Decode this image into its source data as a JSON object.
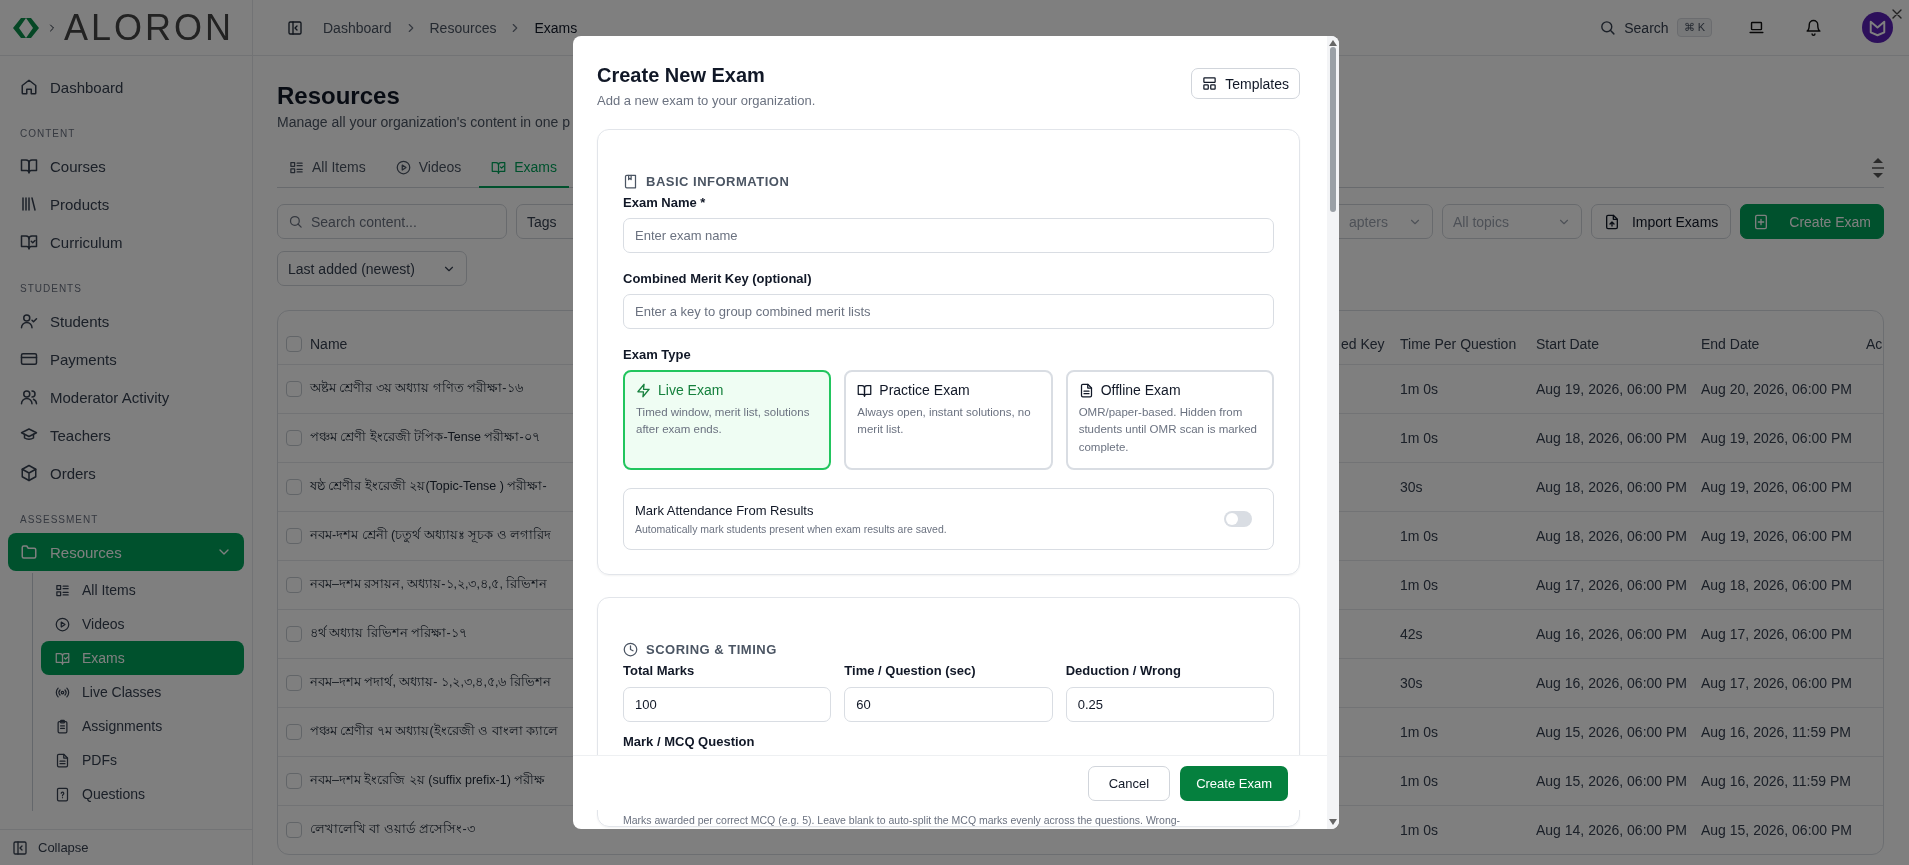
{
  "sidebar": {
    "logo": "ALORON",
    "groups": [
      {
        "items": [
          {
            "label": "Dashboard",
            "selected": false
          }
        ]
      },
      {
        "heading": "CONTENT",
        "items": [
          {
            "label": "Courses",
            "selected": false
          },
          {
            "label": "Products",
            "selected": false
          },
          {
            "label": "Curriculum",
            "selected": false
          }
        ]
      },
      {
        "heading": "STUDENTS",
        "items": [
          {
            "label": "Students",
            "selected": false
          },
          {
            "label": "Payments",
            "selected": false
          },
          {
            "label": "Moderator Activity",
            "selected": false
          },
          {
            "label": "Teachers",
            "selected": false
          },
          {
            "label": "Orders",
            "selected": false
          }
        ]
      },
      {
        "heading": "ASSESSMENT",
        "items": [
          {
            "label": "Resources",
            "selected": true,
            "expanded": true,
            "children": [
              {
                "label": "All Items",
                "selected": false
              },
              {
                "label": "Videos",
                "selected": false
              },
              {
                "label": "Exams",
                "selected": true
              },
              {
                "label": "Live Classes",
                "selected": false
              },
              {
                "label": "Assignments",
                "selected": false
              },
              {
                "label": "PDFs",
                "selected": false
              },
              {
                "label": "Questions",
                "selected": false
              }
            ]
          }
        ]
      }
    ],
    "collapse": "Collapse"
  },
  "header": {
    "breadcrumbs": [
      "Dashboard",
      "Resources",
      "Exams"
    ],
    "search": "Search",
    "shortcut": "⌘ K"
  },
  "page": {
    "title": "Resources",
    "subtitle": "Manage all your organization's content in one p",
    "tabs": [
      {
        "label": "All Items",
        "selected": false
      },
      {
        "label": "Videos",
        "selected": false
      },
      {
        "label": "Exams",
        "selected": true
      }
    ],
    "search_placeholder": "Search content...",
    "filters": [
      "Tags",
      "apters",
      "All topics"
    ],
    "import_button": "Import Exams",
    "create_button": "Create Exam",
    "sort": "Last added (newest)"
  },
  "table": {
    "columns": [
      "Name",
      "ed Key",
      "Time Per Question",
      "Start Date",
      "End Date",
      "Ac"
    ],
    "all_checked": false,
    "rows": [
      {
        "checked": false,
        "name": "অষ্টম শ্রেণীর ৩য় অধ্যায় গণিত পরীক্ষা-১৬",
        "time": "1m 0s",
        "start": "Aug 19, 2026, 06:00 PM",
        "end": "Aug 20, 2026, 06:00 PM"
      },
      {
        "checked": false,
        "name": "পঞ্চম শ্রেণী ইংরেজী টপিক-Tense পরীক্ষা-০৭",
        "time": "1m 0s",
        "start": "Aug 18, 2026, 06:00 PM",
        "end": "Aug 19, 2026, 06:00 PM"
      },
      {
        "checked": false,
        "name": "ষষ্ঠ শ্রেণীর ইংরেজী ২য়(Topic-Tense ) পরীক্ষা-",
        "time": "30s",
        "start": "Aug 18, 2026, 06:00 PM",
        "end": "Aug 19, 2026, 06:00 PM"
      },
      {
        "checked": false,
        "name": "নবম-দশম শ্রেনী (চতুর্থ অধ্যায়ঃ সূচক ও লগারিদ",
        "time": "1m 0s",
        "start": "Aug 18, 2026, 06:00 PM",
        "end": "Aug 19, 2026, 06:00 PM"
      },
      {
        "checked": false,
        "name": "নবম–দশম রসায়ন, অধ্যায়-১,২,৩,৪,৫, রিভিশন",
        "time": "1m 0s",
        "start": "Aug 17, 2026, 06:00 PM",
        "end": "Aug 18, 2026, 06:00 PM"
      },
      {
        "checked": false,
        "name": "৪র্থ অধ্যায় রিভিশন পরিক্ষা-১৭",
        "time": "42s",
        "start": "Aug 16, 2026, 06:00 PM",
        "end": "Aug 17, 2026, 06:00 PM"
      },
      {
        "checked": false,
        "name": "নবম–দশম পদার্থ, অধ্যায়- ১,২,৩,৪,৫,৬ রিভিশন",
        "time": "30s",
        "start": "Aug 16, 2026, 06:00 PM",
        "end": "Aug 17, 2026, 06:00 PM"
      },
      {
        "checked": false,
        "name": "পঞ্চম শ্রেণীর ৭ম অধ্যায়(ইংরেজী ও বাংলা ক্যালে",
        "time": "1m 0s",
        "start": "Aug 15, 2026, 06:00 PM",
        "end": "Aug 16, 2026, 11:59 PM"
      },
      {
        "checked": false,
        "name": "নবম–দশম ইংরেজি ২য় (suffix prefix-1) পরীক্ষ",
        "time": "1m 0s",
        "start": "Aug 15, 2026, 06:00 PM",
        "end": "Aug 16, 2026, 11:59 PM"
      },
      {
        "checked": false,
        "name": "লেখালেখি বা ওয়ার্ড প্রসেসিং-৩",
        "time": "1m 0s",
        "start": "Aug 14, 2026, 06:00 PM",
        "end": "Aug 15, 2026, 06:00 PM"
      }
    ]
  },
  "modal": {
    "title": "Create New Exam",
    "subtitle": "Add a new exam to your organization.",
    "templates_button": "Templates",
    "basic": {
      "heading": "BASIC INFORMATION",
      "fields": [
        {
          "label": "Exam Name *",
          "placeholder": "Enter exam name"
        },
        {
          "label": "Combined Merit Key (optional)",
          "placeholder": "Enter a key to group combined merit lists"
        }
      ],
      "exam_type_label": "Exam Type",
      "exam_types": [
        {
          "title": "Live Exam",
          "description": "Timed window, merit list, solutions after exam ends.",
          "selected": true
        },
        {
          "title": "Practice Exam",
          "description": "Always open, instant solutions, no merit list.",
          "selected": false
        },
        {
          "title": "Offline Exam",
          "description": "OMR/paper-based. Hidden from students until OMR scan is marked complete.",
          "selected": false
        }
      ],
      "attendance": {
        "title": "Mark Attendance From Results",
        "description": "Automatically mark students present when exam results are saved.",
        "on": false
      }
    },
    "scoring": {
      "heading": "SCORING & TIMING",
      "fields": [
        {
          "label": "Total Marks",
          "value": "100"
        },
        {
          "label": "Time / Question (sec)",
          "value": "60"
        },
        {
          "label": "Deduction / Wrong",
          "value": "0.25"
        }
      ],
      "mcq_label": "Mark / MCQ Question",
      "help": "Marks awarded per correct MCQ (e.g. 5). Leave blank to auto-split the MCQ marks evenly across the questions. Wrong-"
    },
    "cancel_button": "Cancel",
    "submit_button": "Create Exam"
  }
}
